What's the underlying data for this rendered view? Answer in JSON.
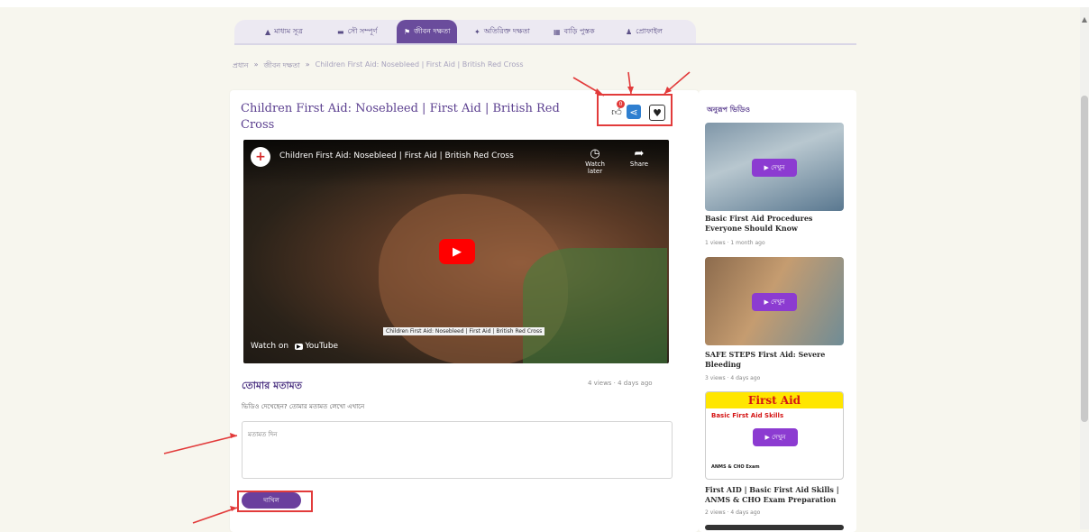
{
  "colors": {
    "accent": "#6a4c9c",
    "annotation": "#e23b3b",
    "share": "#2f7fd0",
    "youtube": "#ff0000"
  },
  "tabs": [
    {
      "label": "মাধ্যম সূত্র",
      "icon": "home-icon"
    },
    {
      "label": "সৌ সম্পূর্ণ",
      "icon": "book-icon"
    },
    {
      "label": "জীবন দক্ষতা",
      "icon": "skills-icon",
      "active": true
    },
    {
      "label": "অতিরিক্ত দক্ষতা",
      "icon": "star-icon"
    },
    {
      "label": "বাড়ি পুস্তক",
      "icon": "building-icon"
    },
    {
      "label": "প্রোফাইল",
      "icon": "user-icon"
    }
  ],
  "breadcrumb": {
    "home": "প্রধান",
    "section": "জীবন দক্ষতা",
    "current": "Children First Aid: Nosebleed | First Aid | British Red Cross",
    "sep": "»"
  },
  "video_page": {
    "title": "Children First Aid: Nosebleed | First Aid | British Red Cross",
    "like_count": "0",
    "player": {
      "title": "Children First Aid: Nosebleed | First Aid | British Red Cross",
      "channel_initial": "+",
      "watch_later": "Watch later",
      "share": "Share",
      "watch_on": "Watch on",
      "youtube": "YouTube",
      "caption": "Children First Aid: Nosebleed | First Aid | British Red Cross"
    }
  },
  "opinion": {
    "title": "তোমার মতামত",
    "meta": "4 views · 4 days ago",
    "subtitle": "ভিডিও দেখেছেন? তোমার মতামত লেখো এখানে",
    "placeholder": "মতামত দিন",
    "submit": "দাখিল"
  },
  "sidebar": {
    "heading": "অনুরূপ ভিডিও",
    "play_label": "▶ দেখুন",
    "items": [
      {
        "title": "Basic First Aid Procedures Everyone Should Know",
        "meta": "1 views · 1 month ago"
      },
      {
        "title": "SAFE STEPS First Aid: Severe Bleeding",
        "meta": "3 views · 4 days ago"
      },
      {
        "title": "First AID | Basic First Aid Skills | ANMS & CHO Exam Preparation",
        "meta": "2 views · 4 days ago",
        "thumb_top": "First Aid",
        "thumb_mid": "Basic First Aid Skills",
        "thumb_bot": "ANMS & CHO Exam"
      }
    ]
  }
}
